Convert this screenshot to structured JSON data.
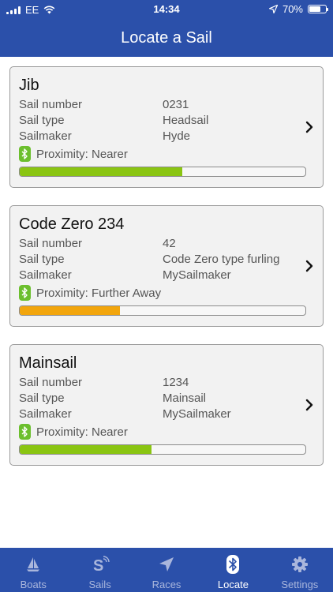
{
  "status": {
    "carrier": "EE",
    "time": "14:34",
    "battery": "70%",
    "battery_level": 0.7
  },
  "header": {
    "title": "Locate a Sail"
  },
  "labels": {
    "sail_number": "Sail number",
    "sail_type": "Sail type",
    "sailmaker": "Sailmaker"
  },
  "sails": [
    {
      "name": "Jib",
      "sail_number": "0231",
      "sail_type": "Headsail",
      "sailmaker": "Hyde",
      "proximity": "Proximity: Nearer",
      "signal_level": 0.57,
      "bar_color": "#8ac512"
    },
    {
      "name": "Code Zero 234",
      "sail_number": "42",
      "sail_type": "Code Zero type furling",
      "sailmaker": "MySailmaker",
      "proximity": "Proximity: Further Away",
      "signal_level": 0.35,
      "bar_color": "#f2a50c"
    },
    {
      "name": "Mainsail",
      "sail_number": "1234",
      "sail_type": "Mainsail",
      "sailmaker": "MySailmaker",
      "proximity": "Proximity: Nearer",
      "signal_level": 0.46,
      "bar_color": "#8ac512"
    }
  ],
  "tabs": [
    {
      "label": "Boats",
      "icon": "sailboat-icon"
    },
    {
      "label": "Sails",
      "icon": "sails-logo-icon"
    },
    {
      "label": "Races",
      "icon": "navigation-arrow-icon"
    },
    {
      "label": "Locate",
      "icon": "bluetooth-icon",
      "active": true
    },
    {
      "label": "Settings",
      "icon": "gear-icon"
    }
  ],
  "colors": {
    "brand": "#2b50aa",
    "nearer": "#8ac512",
    "further": "#f2a50c",
    "bluetooth_badge": "#6cbf2e"
  }
}
